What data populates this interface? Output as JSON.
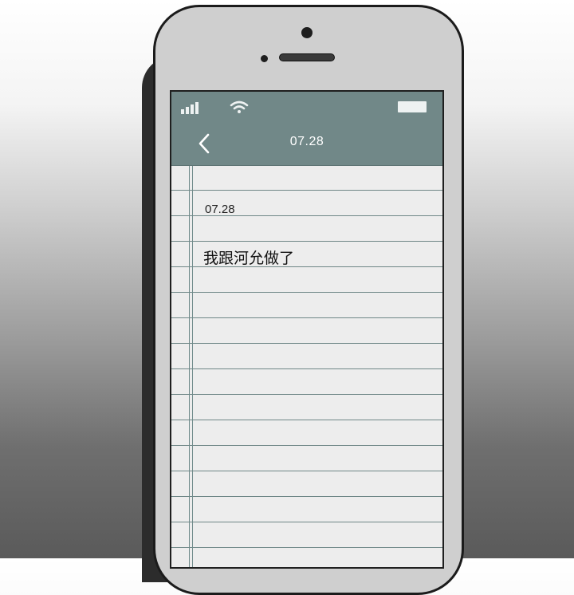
{
  "status_bar": {
    "signal_icon": "signal-bars-icon",
    "wifi_icon": "wifi-icon",
    "battery_icon": "battery-icon"
  },
  "nav": {
    "back_icon": "chevron-left-icon",
    "title": "07.28"
  },
  "note": {
    "date": "07.28",
    "body": "我跟河允做了"
  },
  "colors": {
    "header_bg": "#718888",
    "paper_bg": "#ededed",
    "rule_line": "#6f8787"
  }
}
